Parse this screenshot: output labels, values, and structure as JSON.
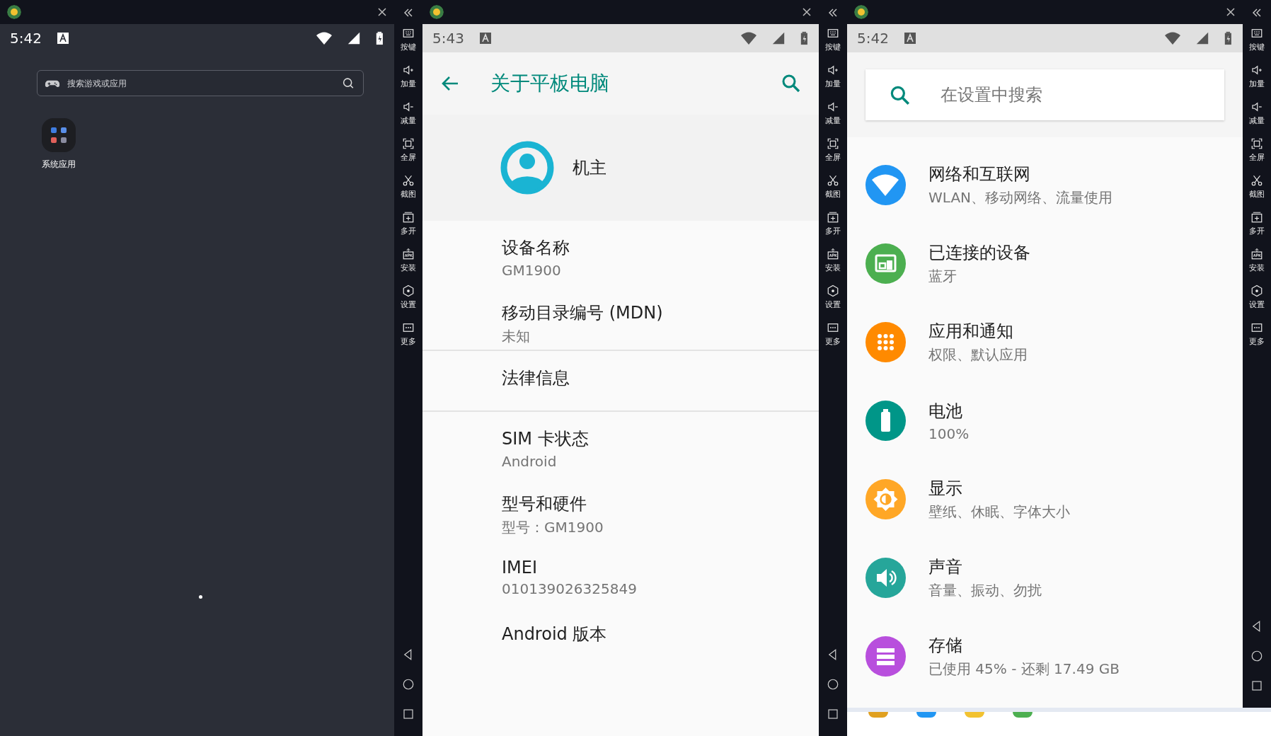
{
  "windows": [
    {
      "kind": "launcher",
      "status_bar": {
        "time": "5:42"
      },
      "search": {
        "placeholder": "搜索游戏或应用"
      },
      "apps": [
        {
          "label": "系统应用"
        }
      ],
      "toolbar": [
        {
          "kind": "keys",
          "label": "按键"
        },
        {
          "kind": "vol_up",
          "label": "加量"
        },
        {
          "kind": "vol_down",
          "label": "减量"
        },
        {
          "kind": "fullscreen",
          "label": "全屏"
        },
        {
          "kind": "screenshot",
          "label": "截图"
        },
        {
          "kind": "multi",
          "label": "多开"
        },
        {
          "kind": "apk",
          "label": "安装"
        },
        {
          "kind": "settings",
          "label": "设置"
        },
        {
          "kind": "more",
          "label": "更多"
        }
      ]
    },
    {
      "kind": "about",
      "status_bar": {
        "time": "5:43"
      },
      "app_bar": {
        "title": "关于平板电脑"
      },
      "owner": {
        "name": "机主"
      },
      "items": [
        {
          "title": "设备名称",
          "summary": "GM1900",
          "divider": false
        },
        {
          "title": "移动目录编号 (MDN)",
          "summary": "未知",
          "divider": true
        },
        {
          "title": "法律信息",
          "divider": true
        },
        {
          "title": "SIM 卡状态",
          "summary": "Android",
          "divider": false
        },
        {
          "title": "型号和硬件",
          "summary": "型号：GM1900",
          "divider": false
        },
        {
          "title": "IMEI",
          "summary": "010139026325849",
          "divider": false
        },
        {
          "title": "Android 版本",
          "divider": false
        }
      ],
      "toolbar": [
        {
          "kind": "keys",
          "label": "按键"
        },
        {
          "kind": "vol_up",
          "label": "加量"
        },
        {
          "kind": "vol_down",
          "label": "减量"
        },
        {
          "kind": "fullscreen",
          "label": "全屏"
        },
        {
          "kind": "screenshot",
          "label": "截图"
        },
        {
          "kind": "multi",
          "label": "多开"
        },
        {
          "kind": "apk",
          "label": "安装"
        },
        {
          "kind": "settings",
          "label": "设置"
        },
        {
          "kind": "more",
          "label": "更多"
        }
      ]
    },
    {
      "kind": "settings",
      "status_bar": {
        "time": "5:42"
      },
      "search": {
        "placeholder": "在设置中搜索"
      },
      "items": [
        {
          "kind": "wifi",
          "color": "#2196f3",
          "title": "网络和互联网",
          "summary": "WLAN、移动网络、流量使用"
        },
        {
          "kind": "devices",
          "color": "#4caf50",
          "title": "已连接的设备",
          "summary": "蓝牙"
        },
        {
          "kind": "apps",
          "color": "#ff8a00",
          "title": "应用和通知",
          "summary": "权限、默认应用"
        },
        {
          "kind": "battery",
          "color": "#009688",
          "title": "电池",
          "summary": "100%"
        },
        {
          "kind": "display",
          "color": "#ffa726",
          "title": "显示",
          "summary": "壁纸、休眠、字体大小"
        },
        {
          "kind": "sound",
          "color": "#26a69a",
          "title": "声音",
          "summary": "音量、振动、勿扰"
        },
        {
          "kind": "storage",
          "color": "#b84fdd",
          "title": "存储",
          "summary": "已使用 45% - 还剩 17.49 GB"
        }
      ],
      "toolbar": [
        {
          "kind": "keys",
          "label": "按键"
        },
        {
          "kind": "vol_up",
          "label": "加量"
        },
        {
          "kind": "vol_down",
          "label": "减量"
        },
        {
          "kind": "fullscreen",
          "label": "全屏"
        },
        {
          "kind": "screenshot",
          "label": "截图"
        },
        {
          "kind": "multi",
          "label": "多开"
        },
        {
          "kind": "apk",
          "label": "安装"
        },
        {
          "kind": "settings",
          "label": "设置"
        },
        {
          "kind": "more",
          "label": "更多"
        }
      ]
    }
  ]
}
